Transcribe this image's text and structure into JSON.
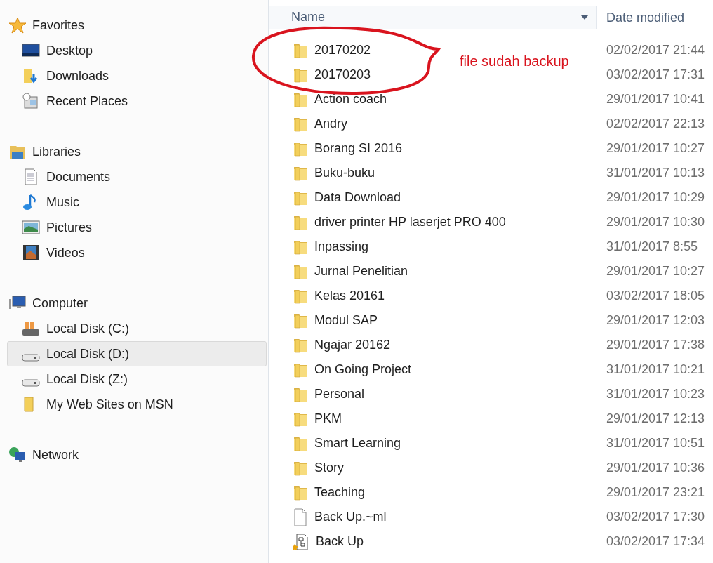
{
  "sidebar": {
    "sections": [
      {
        "label": "Favorites",
        "children": [
          {
            "label": "Desktop",
            "selected": false
          },
          {
            "label": "Downloads",
            "selected": false
          },
          {
            "label": "Recent Places",
            "selected": false
          }
        ]
      },
      {
        "label": "Libraries",
        "children": [
          {
            "label": "Documents",
            "selected": false
          },
          {
            "label": "Music",
            "selected": false
          },
          {
            "label": "Pictures",
            "selected": false
          },
          {
            "label": "Videos",
            "selected": false
          }
        ]
      },
      {
        "label": "Computer",
        "children": [
          {
            "label": "Local Disk (C:)",
            "selected": false
          },
          {
            "label": "Local Disk (D:)",
            "selected": true
          },
          {
            "label": "Local Disk (Z:)",
            "selected": false
          },
          {
            "label": "My Web Sites on MSN",
            "selected": false
          }
        ]
      },
      {
        "label": "Network"
      }
    ]
  },
  "table": {
    "columns": [
      "Name",
      "Date modified"
    ],
    "rows": [
      {
        "kind": "folder",
        "name": "20170202",
        "date": "02/02/2017 21:44"
      },
      {
        "kind": "folder",
        "name": "20170203",
        "date": "03/02/2017 17:31"
      },
      {
        "kind": "folder",
        "name": "Action coach",
        "date": "29/01/2017 10:41"
      },
      {
        "kind": "folder",
        "name": "Andry",
        "date": "02/02/2017 22:13"
      },
      {
        "kind": "folder",
        "name": "Borang SI 2016",
        "date": "29/01/2017 10:27"
      },
      {
        "kind": "folder",
        "name": "Buku-buku",
        "date": "31/01/2017 10:13"
      },
      {
        "kind": "folder",
        "name": "Data Download",
        "date": "29/01/2017 10:29"
      },
      {
        "kind": "folder",
        "name": "driver printer HP laserjet PRO 400",
        "date": "29/01/2017 10:30"
      },
      {
        "kind": "folder",
        "name": "Inpassing",
        "date": "31/01/2017 8:55"
      },
      {
        "kind": "folder",
        "name": "Jurnal Penelitian",
        "date": "29/01/2017 10:27"
      },
      {
        "kind": "folder",
        "name": "Kelas 20161",
        "date": "03/02/2017 18:05"
      },
      {
        "kind": "folder",
        "name": "Modul SAP",
        "date": "29/01/2017 12:03"
      },
      {
        "kind": "folder",
        "name": "Ngajar 20162",
        "date": "29/01/2017 17:38"
      },
      {
        "kind": "folder",
        "name": "On Going Project",
        "date": "31/01/2017 10:21"
      },
      {
        "kind": "folder",
        "name": "Personal",
        "date": "31/01/2017 10:23"
      },
      {
        "kind": "folder",
        "name": "PKM",
        "date": "29/01/2017 12:13"
      },
      {
        "kind": "folder",
        "name": "Smart Learning",
        "date": "31/01/2017 10:51"
      },
      {
        "kind": "folder",
        "name": "Story",
        "date": "29/01/2017 10:36"
      },
      {
        "kind": "folder",
        "name": "Teaching",
        "date": "29/01/2017 23:21"
      },
      {
        "kind": "file",
        "name": "Back Up.~ml",
        "date": "03/02/2017 17:30"
      },
      {
        "kind": "document",
        "name": "Back Up",
        "date": "03/02/2017 17:34"
      }
    ]
  },
  "annotation": {
    "text": "file sudah backup"
  }
}
